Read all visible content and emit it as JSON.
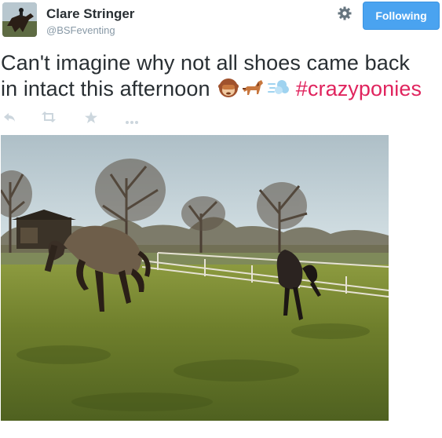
{
  "user": {
    "name": "Clare Stringer",
    "handle": "@BSFeventing"
  },
  "header": {
    "follow_label": "Following",
    "settings_icon": "gear-icon"
  },
  "tweet": {
    "text_line1": "Can't imagine why not all shoes came back",
    "text_line2": "in intact this afternoon",
    "hashtag": "#crazyponies",
    "emojis": [
      "see-no-evil-monkey",
      "horse",
      "dash"
    ]
  },
  "actions": {
    "icons": [
      "reply-icon",
      "retweet-icon",
      "favorite-icon",
      "more-icon"
    ]
  },
  "colors": {
    "follow_button": "#4aa3f0",
    "hashtag": "#e0245e",
    "handle": "#8899a6",
    "action_icons": "#ccd6dd"
  }
}
